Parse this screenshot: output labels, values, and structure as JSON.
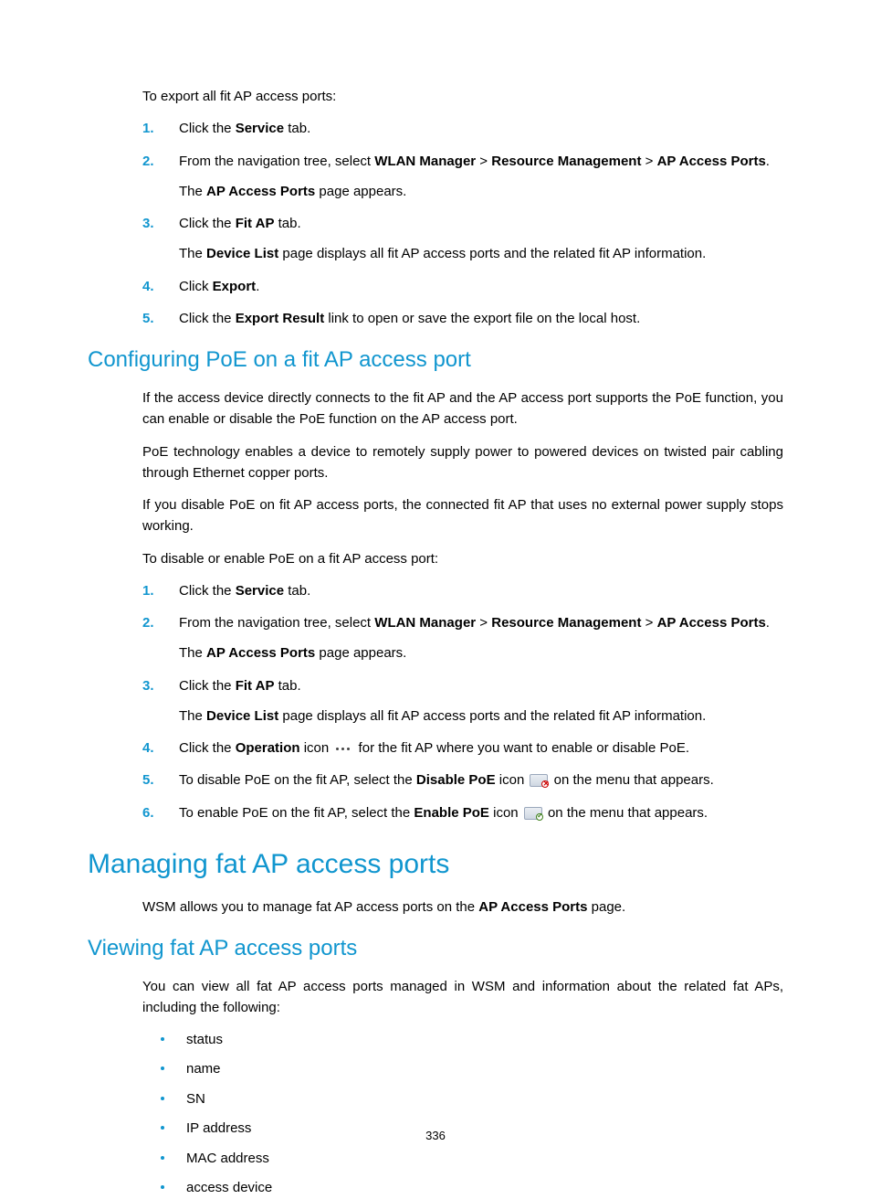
{
  "intro": {
    "lead": "To export all fit AP access ports:"
  },
  "steps1": [
    {
      "pre": "Click the ",
      "bold": "Service",
      "post": " tab."
    },
    {
      "pre": "From the navigation tree, select ",
      "b1": "WLAN Manager",
      "sep1": " > ",
      "b2": "Resource Management",
      "sep2": " > ",
      "b3": "AP Access Ports",
      "post": ".",
      "sub_pre": "The ",
      "sub_b": "AP Access Ports",
      "sub_post": " page appears."
    },
    {
      "pre": "Click the ",
      "bold": "Fit AP",
      "post": " tab.",
      "sub_pre": "The ",
      "sub_b": "Device List",
      "sub_post": " page displays all fit AP access ports and the related fit AP information."
    },
    {
      "pre": "Click ",
      "bold": "Export",
      "post": "."
    },
    {
      "pre": "Click the ",
      "bold": "Export Result",
      "post": " link to open or save the export file on the local host."
    }
  ],
  "h2_poe": "Configuring PoE on a fit AP access port",
  "poe_p1": "If the access device directly connects to the fit AP and the AP access port supports the PoE function, you can enable or disable the PoE function on the AP access port.",
  "poe_p2": "PoE technology enables a device to remotely supply power to powered devices on twisted pair cabling through Ethernet copper ports.",
  "poe_p3": "If you disable PoE on fit AP access ports, the connected fit AP that uses no external power supply stops working.",
  "poe_lead": "To disable or enable PoE on a fit AP access port:",
  "steps2": {
    "s1": {
      "pre": "Click the ",
      "bold": "Service",
      "post": " tab."
    },
    "s2": {
      "pre": "From the navigation tree, select ",
      "b1": "WLAN Manager",
      "sep1": " > ",
      "b2": "Resource Management",
      "sep2": " > ",
      "b3": "AP Access Ports",
      "post": ".",
      "sub_pre": "The ",
      "sub_b": "AP Access Ports",
      "sub_post": " page appears."
    },
    "s3": {
      "pre": "Click the ",
      "bold": "Fit AP",
      "post": " tab.",
      "sub_pre": "The ",
      "sub_b": "Device List",
      "sub_post": " page displays all fit AP access ports and the related fit AP information."
    },
    "s4": {
      "pre": "Click the ",
      "bold": "Operation",
      "mid": " icon ",
      "post": " for the fit AP where you want to enable or disable PoE."
    },
    "s5": {
      "pre": "To disable PoE on the fit AP, select the ",
      "bold": "Disable PoE",
      "mid": " icon ",
      "post": " on the menu that appears."
    },
    "s6": {
      "pre": "To enable PoE on the fit AP, select the ",
      "bold": "Enable PoE",
      "mid": " icon ",
      "post": " on the menu that appears."
    }
  },
  "h1_fat": "Managing fat AP access ports",
  "fat_p1_pre": "WSM allows you to manage fat AP access ports on the ",
  "fat_p1_b": "AP Access Ports",
  "fat_p1_post": " page.",
  "h2_view": "Viewing fat AP access ports",
  "view_p1": "You can view all fat AP access ports managed in WSM and information about the related fat APs, including the following:",
  "bullets": [
    "status",
    "name",
    "SN",
    "IP address",
    "MAC address",
    "access device"
  ],
  "page_num": "336"
}
